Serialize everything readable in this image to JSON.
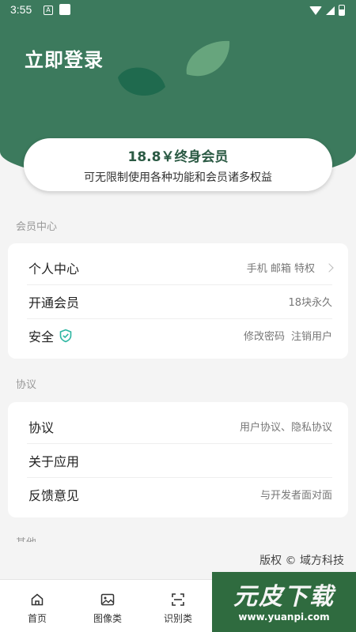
{
  "status_bar": {
    "time": "3:55",
    "notif_letter": "A"
  },
  "header": {
    "login_label": "立即登录"
  },
  "vip_card": {
    "price_title": "18.8￥终身会员",
    "subtitle": "可无限制使用各种功能和会员诸多权益"
  },
  "sections": [
    {
      "title": "会员中心",
      "rows": [
        {
          "label": "个人中心",
          "value": "手机 邮箱 特权"
        },
        {
          "label": "开通会员",
          "value": "18块永久"
        },
        {
          "label": "安全",
          "value_a": "修改密码",
          "value_b": "注销用户"
        }
      ]
    },
    {
      "title": "协议",
      "rows": [
        {
          "label": "协议",
          "value": "用户协议、隐私协议"
        },
        {
          "label": "关于应用",
          "value": ""
        },
        {
          "label": "反馈意见",
          "value": "与开发者面对面"
        }
      ]
    },
    {
      "title": "其他"
    }
  ],
  "copyright": "版权 © 域方科技",
  "tabbar": {
    "tabs": [
      {
        "label": "首页",
        "icon": "home-icon"
      },
      {
        "label": "图像类",
        "icon": "image-icon"
      },
      {
        "label": "识别类",
        "icon": "scan-icon"
      }
    ]
  },
  "watermark": {
    "title": "元皮下载",
    "url": "www.yuanpi.com"
  },
  "colors": {
    "primary": "#3c7a5d",
    "accent_shield": "#2bb5a0"
  }
}
